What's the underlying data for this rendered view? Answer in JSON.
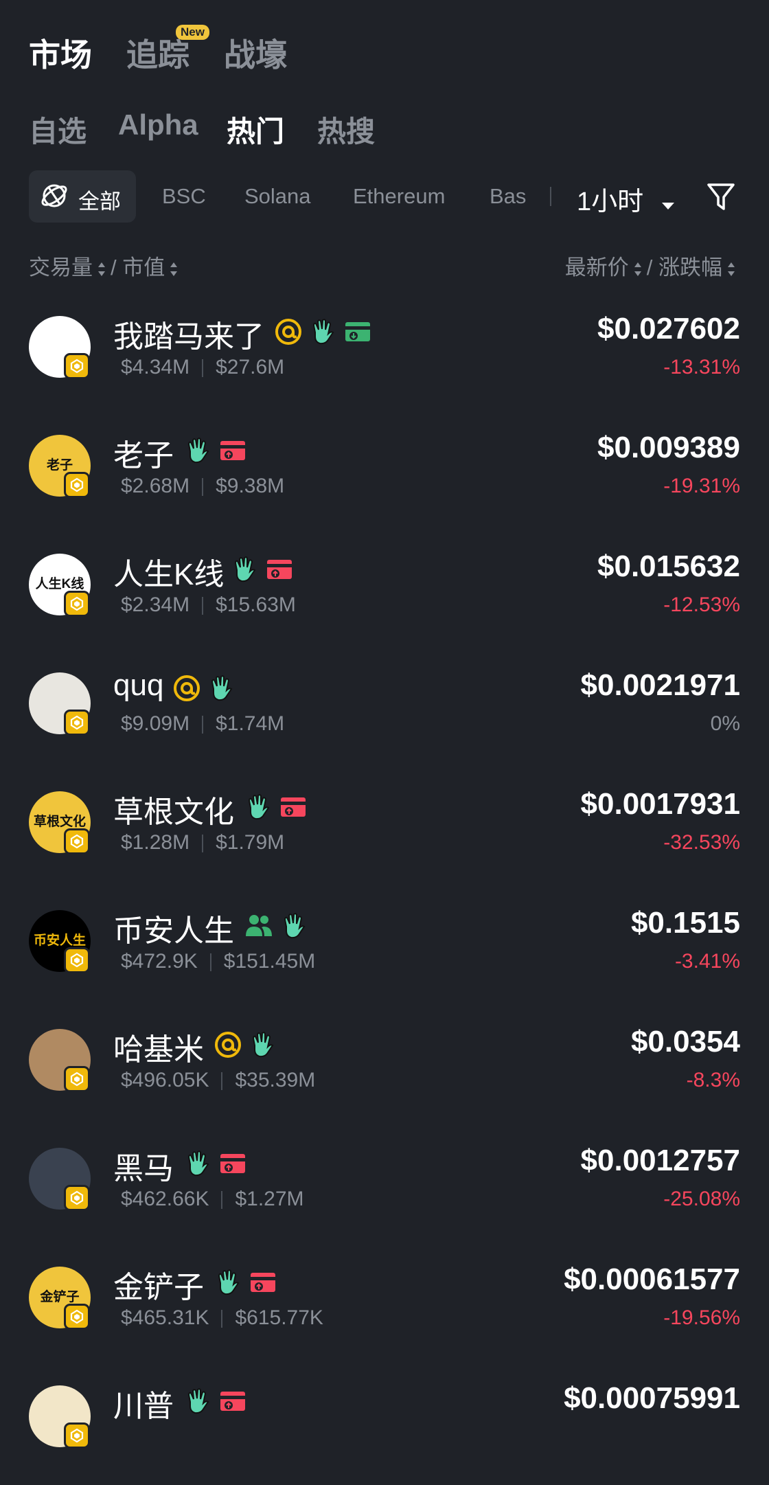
{
  "top_tabs": [
    {
      "label": "市场",
      "active": true
    },
    {
      "label": "追踪",
      "active": false,
      "badge": "New"
    },
    {
      "label": "战壕",
      "active": false
    }
  ],
  "sub_tabs": [
    {
      "label": "自选",
      "active": false
    },
    {
      "label": "Alpha",
      "active": false
    },
    {
      "label": "热门",
      "active": true
    },
    {
      "label": "热搜",
      "active": false
    }
  ],
  "chains": {
    "all": "全部",
    "items": [
      "BSC",
      "Solana",
      "Ethereum",
      "Bas"
    ]
  },
  "period": "1小时",
  "sort": {
    "volume": "交易量",
    "mcap": "市值",
    "price": "最新价",
    "change": "涨跌幅",
    "divider": "/"
  },
  "colors": {
    "background": "#1f2228",
    "negative": "#f6465d",
    "positive_tag": "#3cb371",
    "gold": "#f0b90b",
    "muted": "#8b9098"
  },
  "tokens": [
    {
      "name": "我踏马来了",
      "tags": [
        "at-icon",
        "hand-icon",
        "card-green-icon"
      ],
      "volume": "$4.34M",
      "mcap": "$27.6M",
      "price": "$0.027602",
      "change": "-13.31%",
      "avatar": "horse",
      "avatar_text": ""
    },
    {
      "name": "老子",
      "tags": [
        "hand-icon",
        "card-red-icon"
      ],
      "volume": "$2.68M",
      "mcap": "$9.38M",
      "price": "$0.009389",
      "change": "-19.31%",
      "avatar": "yellow",
      "avatar_text": "老子"
    },
    {
      "name": "人生K线",
      "tags": [
        "hand-icon",
        "card-red-icon"
      ],
      "volume": "$2.34M",
      "mcap": "$15.63M",
      "price": "$0.015632",
      "change": "-12.53%",
      "avatar": "white",
      "avatar_text": "人生K线"
    },
    {
      "name": "quq",
      "tags": [
        "at-icon",
        "hand-icon"
      ],
      "volume": "$9.09M",
      "mcap": "$1.74M",
      "price": "$0.0021971",
      "change": "0%",
      "avatar": "face",
      "avatar_text": ""
    },
    {
      "name": "草根文化",
      "tags": [
        "hand-icon",
        "card-red-icon"
      ],
      "volume": "$1.28M",
      "mcap": "$1.79M",
      "price": "$0.0017931",
      "change": "-32.53%",
      "avatar": "yellow",
      "avatar_text": "草根文化"
    },
    {
      "name": "币安人生",
      "tags": [
        "people-icon",
        "hand-icon"
      ],
      "volume": "$472.9K",
      "mcap": "$151.45M",
      "price": "$0.1515",
      "change": "-3.41%",
      "avatar": "black",
      "avatar_text": "币安人生"
    },
    {
      "name": "哈基米",
      "tags": [
        "at-icon",
        "hand-icon"
      ],
      "volume": "$496.05K",
      "mcap": "$35.39M",
      "price": "$0.0354",
      "change": "-8.3%",
      "avatar": "cat",
      "avatar_text": ""
    },
    {
      "name": "黑马",
      "tags": [
        "hand-icon",
        "card-red-icon"
      ],
      "volume": "$462.66K",
      "mcap": "$1.27M",
      "price": "$0.0012757",
      "change": "-25.08%",
      "avatar": "dark",
      "avatar_text": ""
    },
    {
      "name": "金铲子",
      "tags": [
        "hand-icon",
        "card-red-icon"
      ],
      "volume": "$465.31K",
      "mcap": "$615.77K",
      "price": "$0.00061577",
      "change": "-19.56%",
      "avatar": "yellow",
      "avatar_text": "金铲子"
    },
    {
      "name": "川普",
      "tags": [
        "hand-icon",
        "card-red-icon"
      ],
      "volume": "",
      "mcap": "",
      "price": "$0.00075991",
      "change": "",
      "avatar": "cream",
      "avatar_text": ""
    }
  ]
}
